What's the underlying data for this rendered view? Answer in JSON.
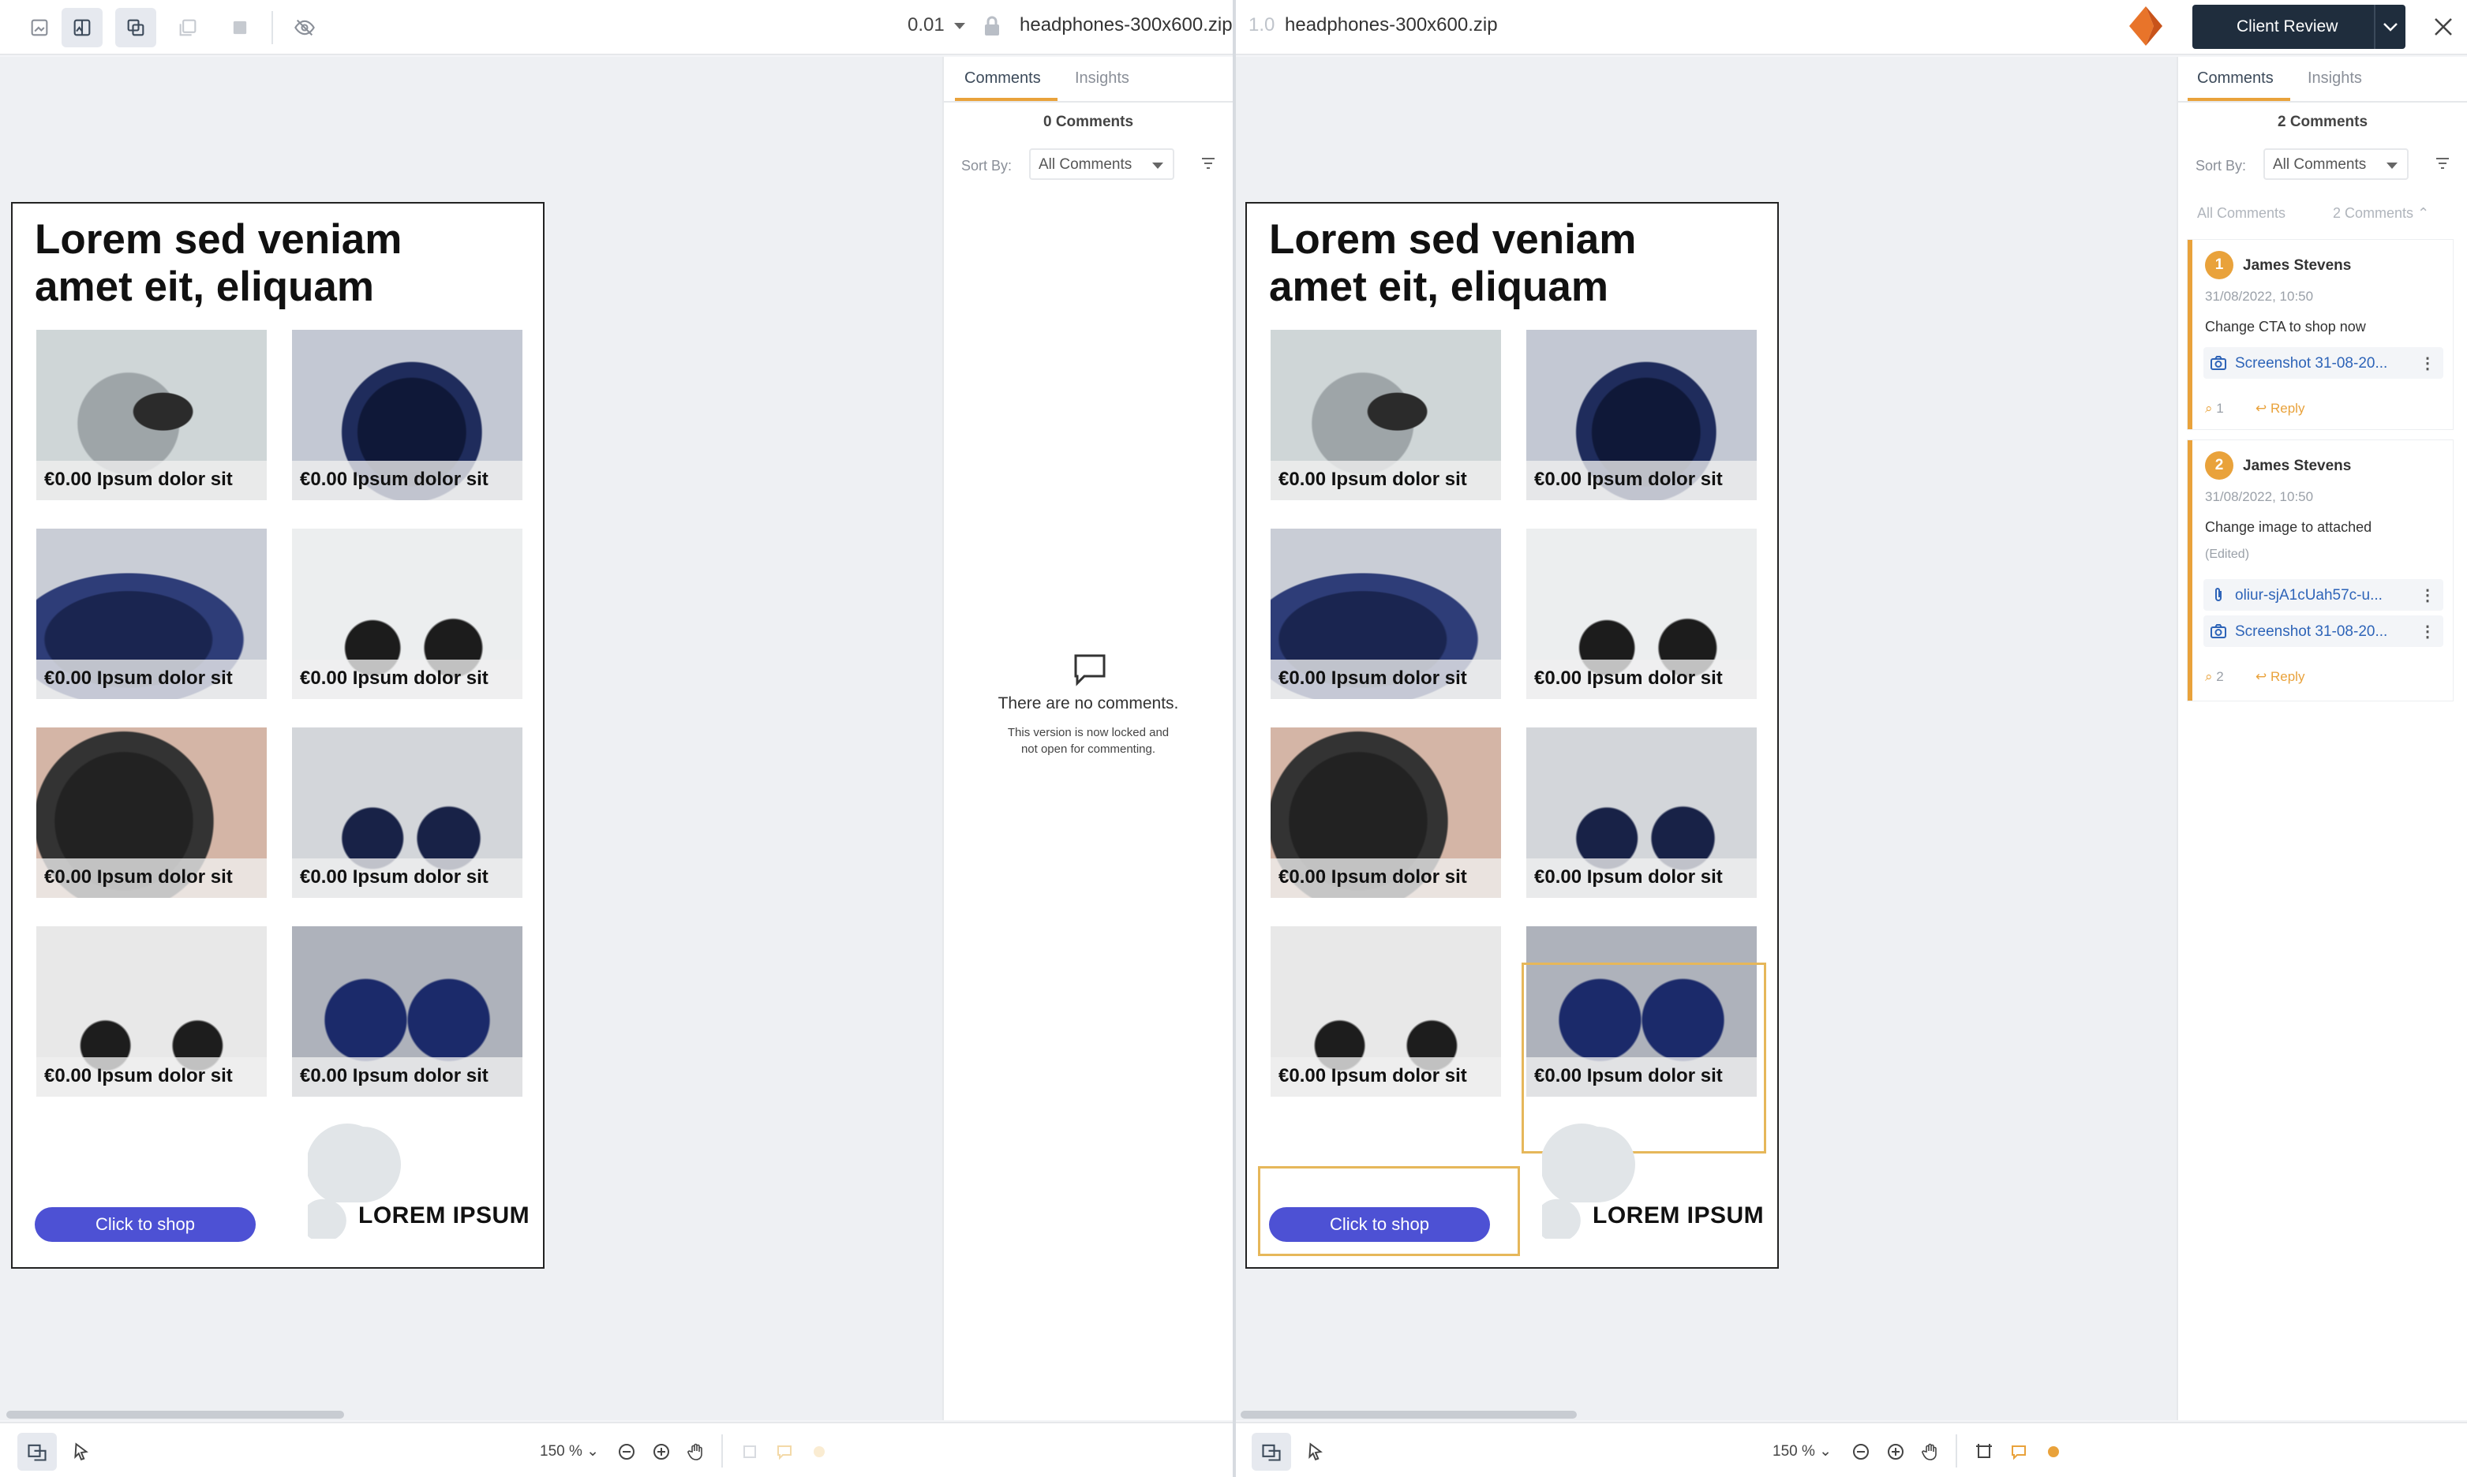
{
  "left": {
    "version": "0.01",
    "filename": "headphones-300x600.zip",
    "comments_tab": "Comments",
    "insights_tab": "Insights",
    "count": "0 Comments",
    "sort_label": "Sort By:",
    "sort_value": "All Comments",
    "empty_title": "There are no comments.",
    "empty_sub": "This version is now locked and not open for commenting.",
    "zoom": "150 %"
  },
  "right": {
    "version": "1.0",
    "filename": "headphones-300x600.zip",
    "review_button": "Client Review",
    "comments_tab": "Comments",
    "insights_tab": "Insights",
    "count": "2 Comments",
    "sort_label": "Sort By:",
    "sort_value": "All Comments",
    "group_label": "All Comments",
    "group_count": "2 Comments",
    "zoom": "150 %",
    "comments": [
      {
        "number": "1",
        "author": "James Stevens",
        "time": "31/08/2022, 10:50",
        "text": "Change CTA to shop now",
        "edited": "",
        "attachments": [
          "Screenshot 31-08-20..."
        ],
        "attach_count": "1",
        "reply": "Reply"
      },
      {
        "number": "2",
        "author": "James Stevens",
        "time": "31/08/2022, 10:50",
        "text": "Change image to attached",
        "edited": "(Edited)",
        "attachments": [
          "oliur-sjA1cUah57c-u...",
          "Screenshot 31-08-20..."
        ],
        "attach_count": "2",
        "reply": "Reply"
      }
    ]
  },
  "ad": {
    "title_line1": "Lorem sed veniam",
    "title_line2": "amet eit, eliquam",
    "price_label": "€0.00 Ipsum dolor sit",
    "cta": "Click to shop",
    "logo_text": "LOREM IPSUM"
  },
  "colors": {
    "accent": "#e9a23b",
    "cta": "#4d51d4",
    "link": "#2e64b8",
    "review_button": "#1f2d3d"
  }
}
